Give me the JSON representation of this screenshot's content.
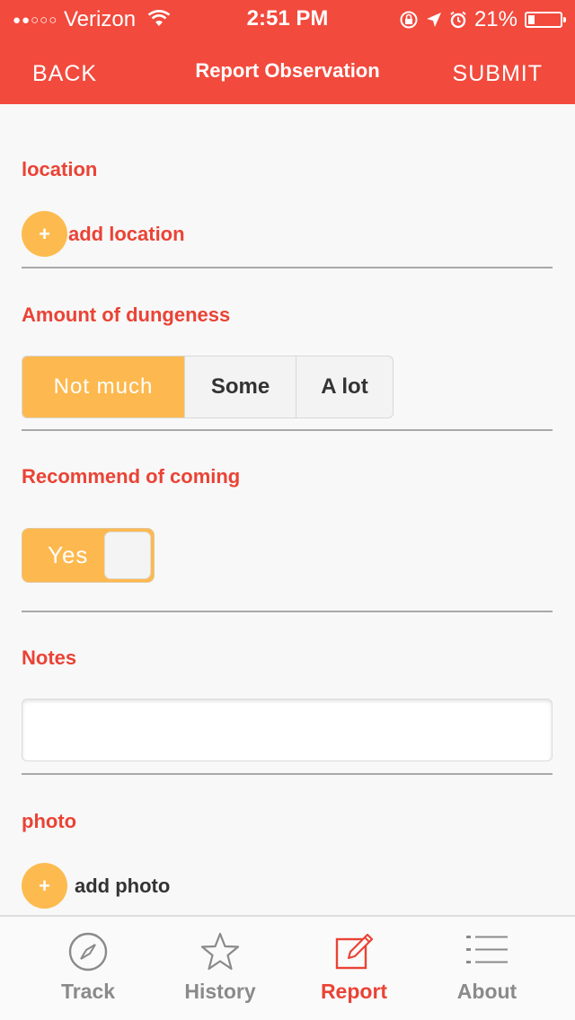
{
  "status": {
    "carrier": "Verizon",
    "time": "2:51 PM",
    "battery": "21%",
    "battery_level": 0.21
  },
  "nav": {
    "back": "BACK",
    "title": "Report Observation",
    "submit": "SUBMIT"
  },
  "location": {
    "label": "location",
    "add": "add location",
    "plus": "+"
  },
  "amount": {
    "label": "Amount of dungeness",
    "options": [
      "Not much",
      "Some",
      "A lot"
    ],
    "selected": "Not much"
  },
  "recommend": {
    "label": "Recommend of coming",
    "toggle_label": "Yes"
  },
  "notes": {
    "label": "Notes",
    "value": ""
  },
  "photo": {
    "label": "photo",
    "add": "add photo",
    "plus": "+"
  },
  "tabs": [
    {
      "label": "Track",
      "icon": "compass-icon"
    },
    {
      "label": "History",
      "icon": "star-icon"
    },
    {
      "label": "Report",
      "icon": "edit-icon",
      "active": true
    },
    {
      "label": "About",
      "icon": "list-icon"
    }
  ],
  "colors": {
    "header": "#f24a3d",
    "accent": "#fdb94f",
    "label_red": "#ea4335"
  }
}
